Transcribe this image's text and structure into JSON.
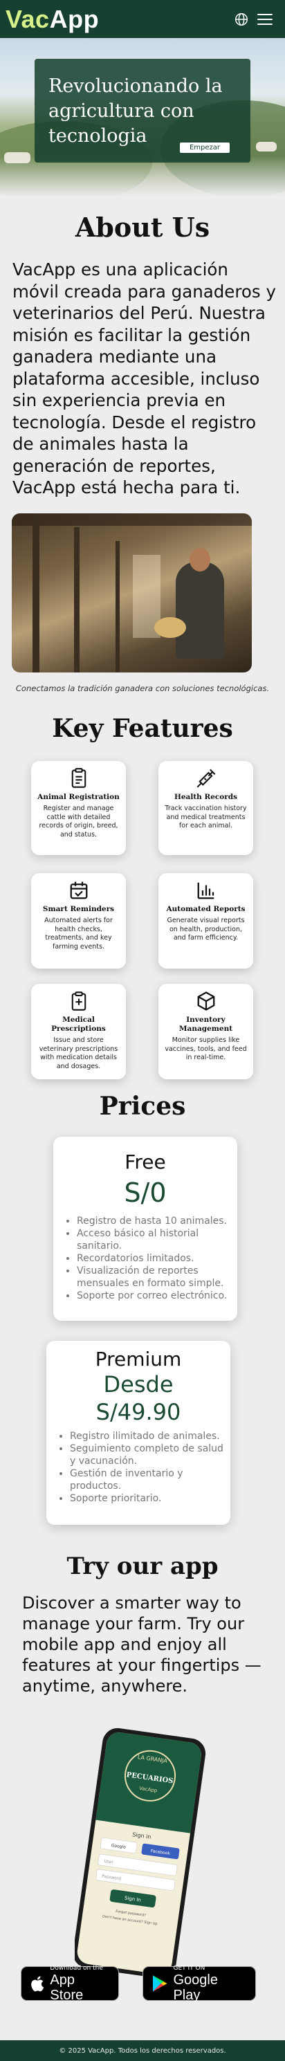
{
  "header": {
    "logo_part1": "Vac",
    "logo_part2": "App",
    "icons": [
      "globe-icon",
      "menu-icon"
    ]
  },
  "hero": {
    "title": "Revolucionando la agricultura con tecnologia",
    "button_label": "Empezar"
  },
  "about": {
    "title": "About Us",
    "text": "VacApp es una aplicación móvil creada para ganaderos y veterinarios del  Perú. Nuestra misión es facilitar la gestión ganadera mediante una plataforma accesible, incluso sin experiencia previa en tecnología.  Desde el registro de animales hasta la generación de reportes, VacApp  está hecha para ti.",
    "caption": "Conectamos la tradición ganadera con soluciones tecnológicas."
  },
  "features": {
    "title": "Key Features",
    "items": [
      {
        "title": "Animal Registration",
        "desc": "Register and manage cattle with detailed records of origin, breed, and status.",
        "icon": "clipboard-icon"
      },
      {
        "title": "Health Records",
        "desc": "Track vaccination history and medical treatments for each animal.",
        "icon": "syringe-icon"
      },
      {
        "title": "Smart Reminders",
        "desc": "Automated alerts for health checks, treatments, and key farming events.",
        "icon": "calendar-check-icon"
      },
      {
        "title": "Automated Reports",
        "desc": "Generate visual reports on health, production, and farm efficiency.",
        "icon": "bar-chart-icon"
      },
      {
        "title": "Medical Prescriptions",
        "desc": "Issue and store veterinary prescriptions with medication details and dosages.",
        "icon": "medical-file-icon"
      },
      {
        "title": "Inventory Management",
        "desc": "Monitor supplies like vaccines, tools, and feed in real-time.",
        "icon": "box-icon"
      }
    ]
  },
  "prices": {
    "title": "Prices",
    "free": {
      "name": "Free",
      "amount": "S/0",
      "items": [
        "Registro de hasta 10 animales.",
        "Acceso básico al historial sanitario.",
        "Recordatorios limitados.",
        "Visualización de reportes mensuales en formato simple.",
        "Soporte por correo electrónico."
      ]
    },
    "premium": {
      "name": "Premium",
      "amount_line1": "Desde",
      "amount_line2": "S/49.90",
      "items": [
        "Registro ilimitado de animales.",
        "Seguimiento completo de salud y vacunación.",
        "Gestión de inventario y productos.",
        "Soporte prioritario."
      ]
    }
  },
  "try_app": {
    "title": "Try our app",
    "text": "Discover a smarter way to manage your farm. Try our mobile app and enjoy all features at your fingertips — anytime, anywhere.",
    "phone_screen": {
      "brand_top": "LA GRANJA",
      "brand_name": "PECUARIOS",
      "brand_sub": "VacApp",
      "sign_in_title": "Sign in",
      "google_label": "Google",
      "facebook_label": "Facebook",
      "user_placeholder": "User",
      "password_placeholder": "Password",
      "sign_in_button": "Sign In",
      "forgot": "Forgot password?",
      "register": "Don't have an account? Sign Up"
    },
    "app_store": {
      "small": "Download on the",
      "big": "App Store"
    },
    "google_play": {
      "small": "GET IT ON",
      "big": "Google Play"
    }
  },
  "footer": {
    "text": "© 2025 VacApp. Todos los derechos reservados."
  },
  "colors": {
    "brand_dark_green": "#16402f",
    "logo_lime": "#d6f08a",
    "price_green": "#1b4a33"
  }
}
